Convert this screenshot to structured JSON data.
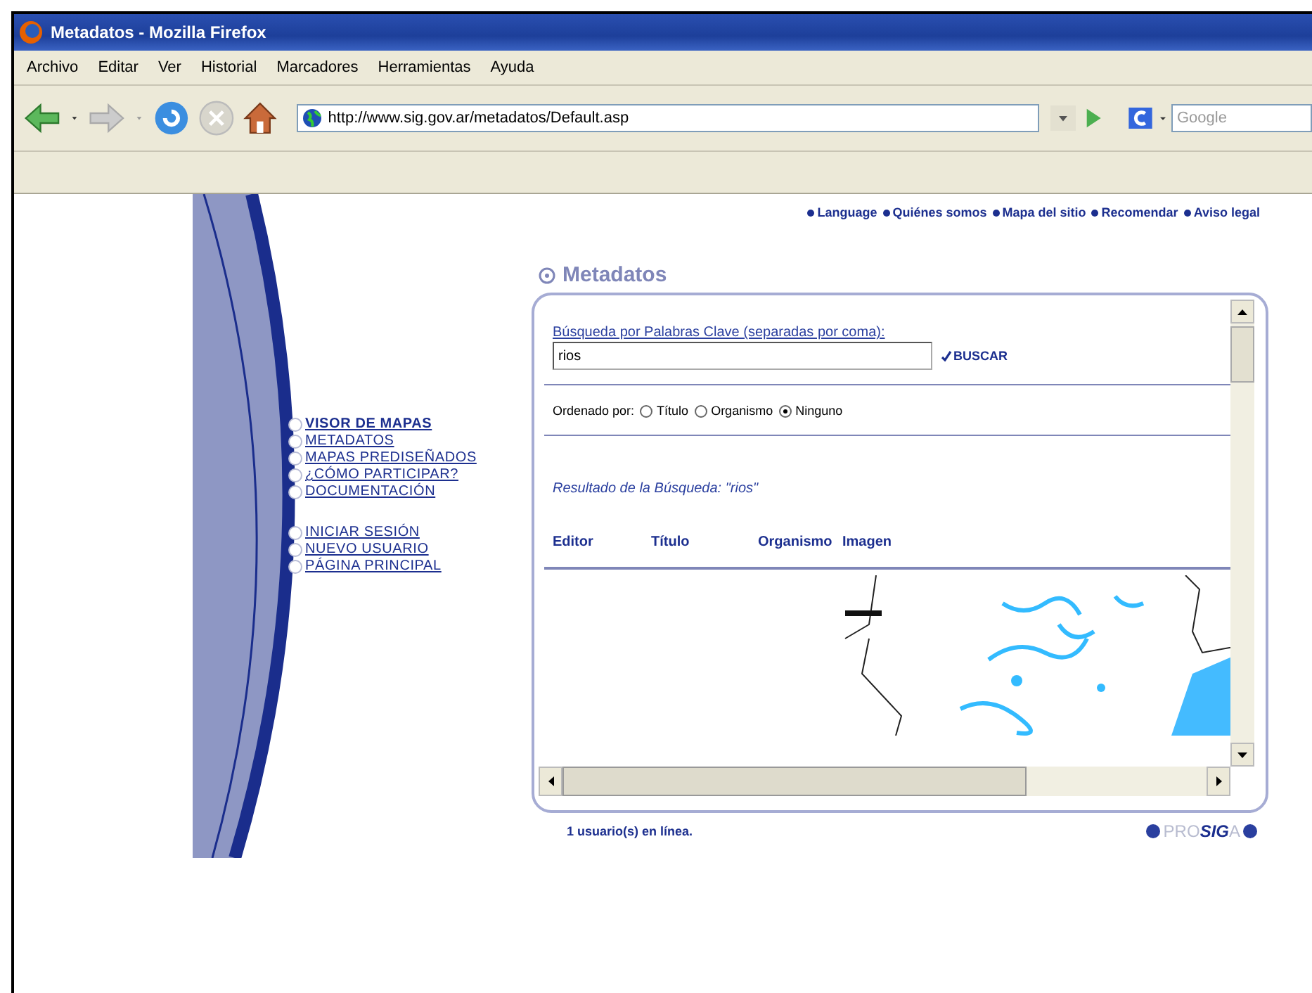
{
  "window": {
    "title": "Metadatos - Mozilla Firefox"
  },
  "menu_bar": [
    "Archivo",
    "Editar",
    "Ver",
    "Historial",
    "Marcadores",
    "Herramientas",
    "Ayuda"
  ],
  "address_bar": {
    "value": "http://www.sig.gov.ar/metadatos/Default.asp"
  },
  "search_bar": {
    "placeholder": "Google"
  },
  "top_links": [
    "Language",
    "Quiénes somos",
    "Mapa del sitio",
    "Recomendar",
    "Aviso legal"
  ],
  "sidebar": {
    "groups": [
      {
        "items": [
          {
            "label": "VISOR DE MAPAS",
            "selected": true
          },
          {
            "label": "METADATOS",
            "selected": false
          },
          {
            "label": "MAPAS PREDISEÑADOS",
            "selected": false
          },
          {
            "label": "¿CÓMO PARTICIPAR?",
            "selected": false
          },
          {
            "label": "DOCUMENTACIÓN",
            "selected": false
          }
        ]
      },
      {
        "items": [
          {
            "label": "INICIAR SESIÓN",
            "selected": false
          },
          {
            "label": "NUEVO USUARIO",
            "selected": false
          },
          {
            "label": "PÁGINA PRINCIPAL",
            "selected": false
          }
        ]
      }
    ]
  },
  "page": {
    "heading": "Metadatos",
    "search": {
      "label": "Búsqueda por Palabras Clave (separadas por coma):",
      "value": "rios",
      "button": "BUSCAR"
    },
    "sort": {
      "label": "Ordenado por:",
      "options": [
        {
          "label": "Título",
          "selected": false
        },
        {
          "label": "Organismo",
          "selected": false
        },
        {
          "label": "Ninguno",
          "selected": true
        }
      ]
    },
    "result_label": "Resultado de la Búsqueda: \"rios\"",
    "columns": [
      "Editor",
      "Título",
      "Organismo",
      "Imagen"
    ],
    "results": [
      {
        "kind": "picture"
      }
    ]
  },
  "footer": {
    "online": "1 usuario(s) en línea.",
    "logo": [
      {
        "text": "PRO",
        "emphasis": false
      },
      {
        "text": "SIG",
        "emphasis": true
      },
      {
        "text": "A",
        "emphasis": false
      }
    ]
  }
}
